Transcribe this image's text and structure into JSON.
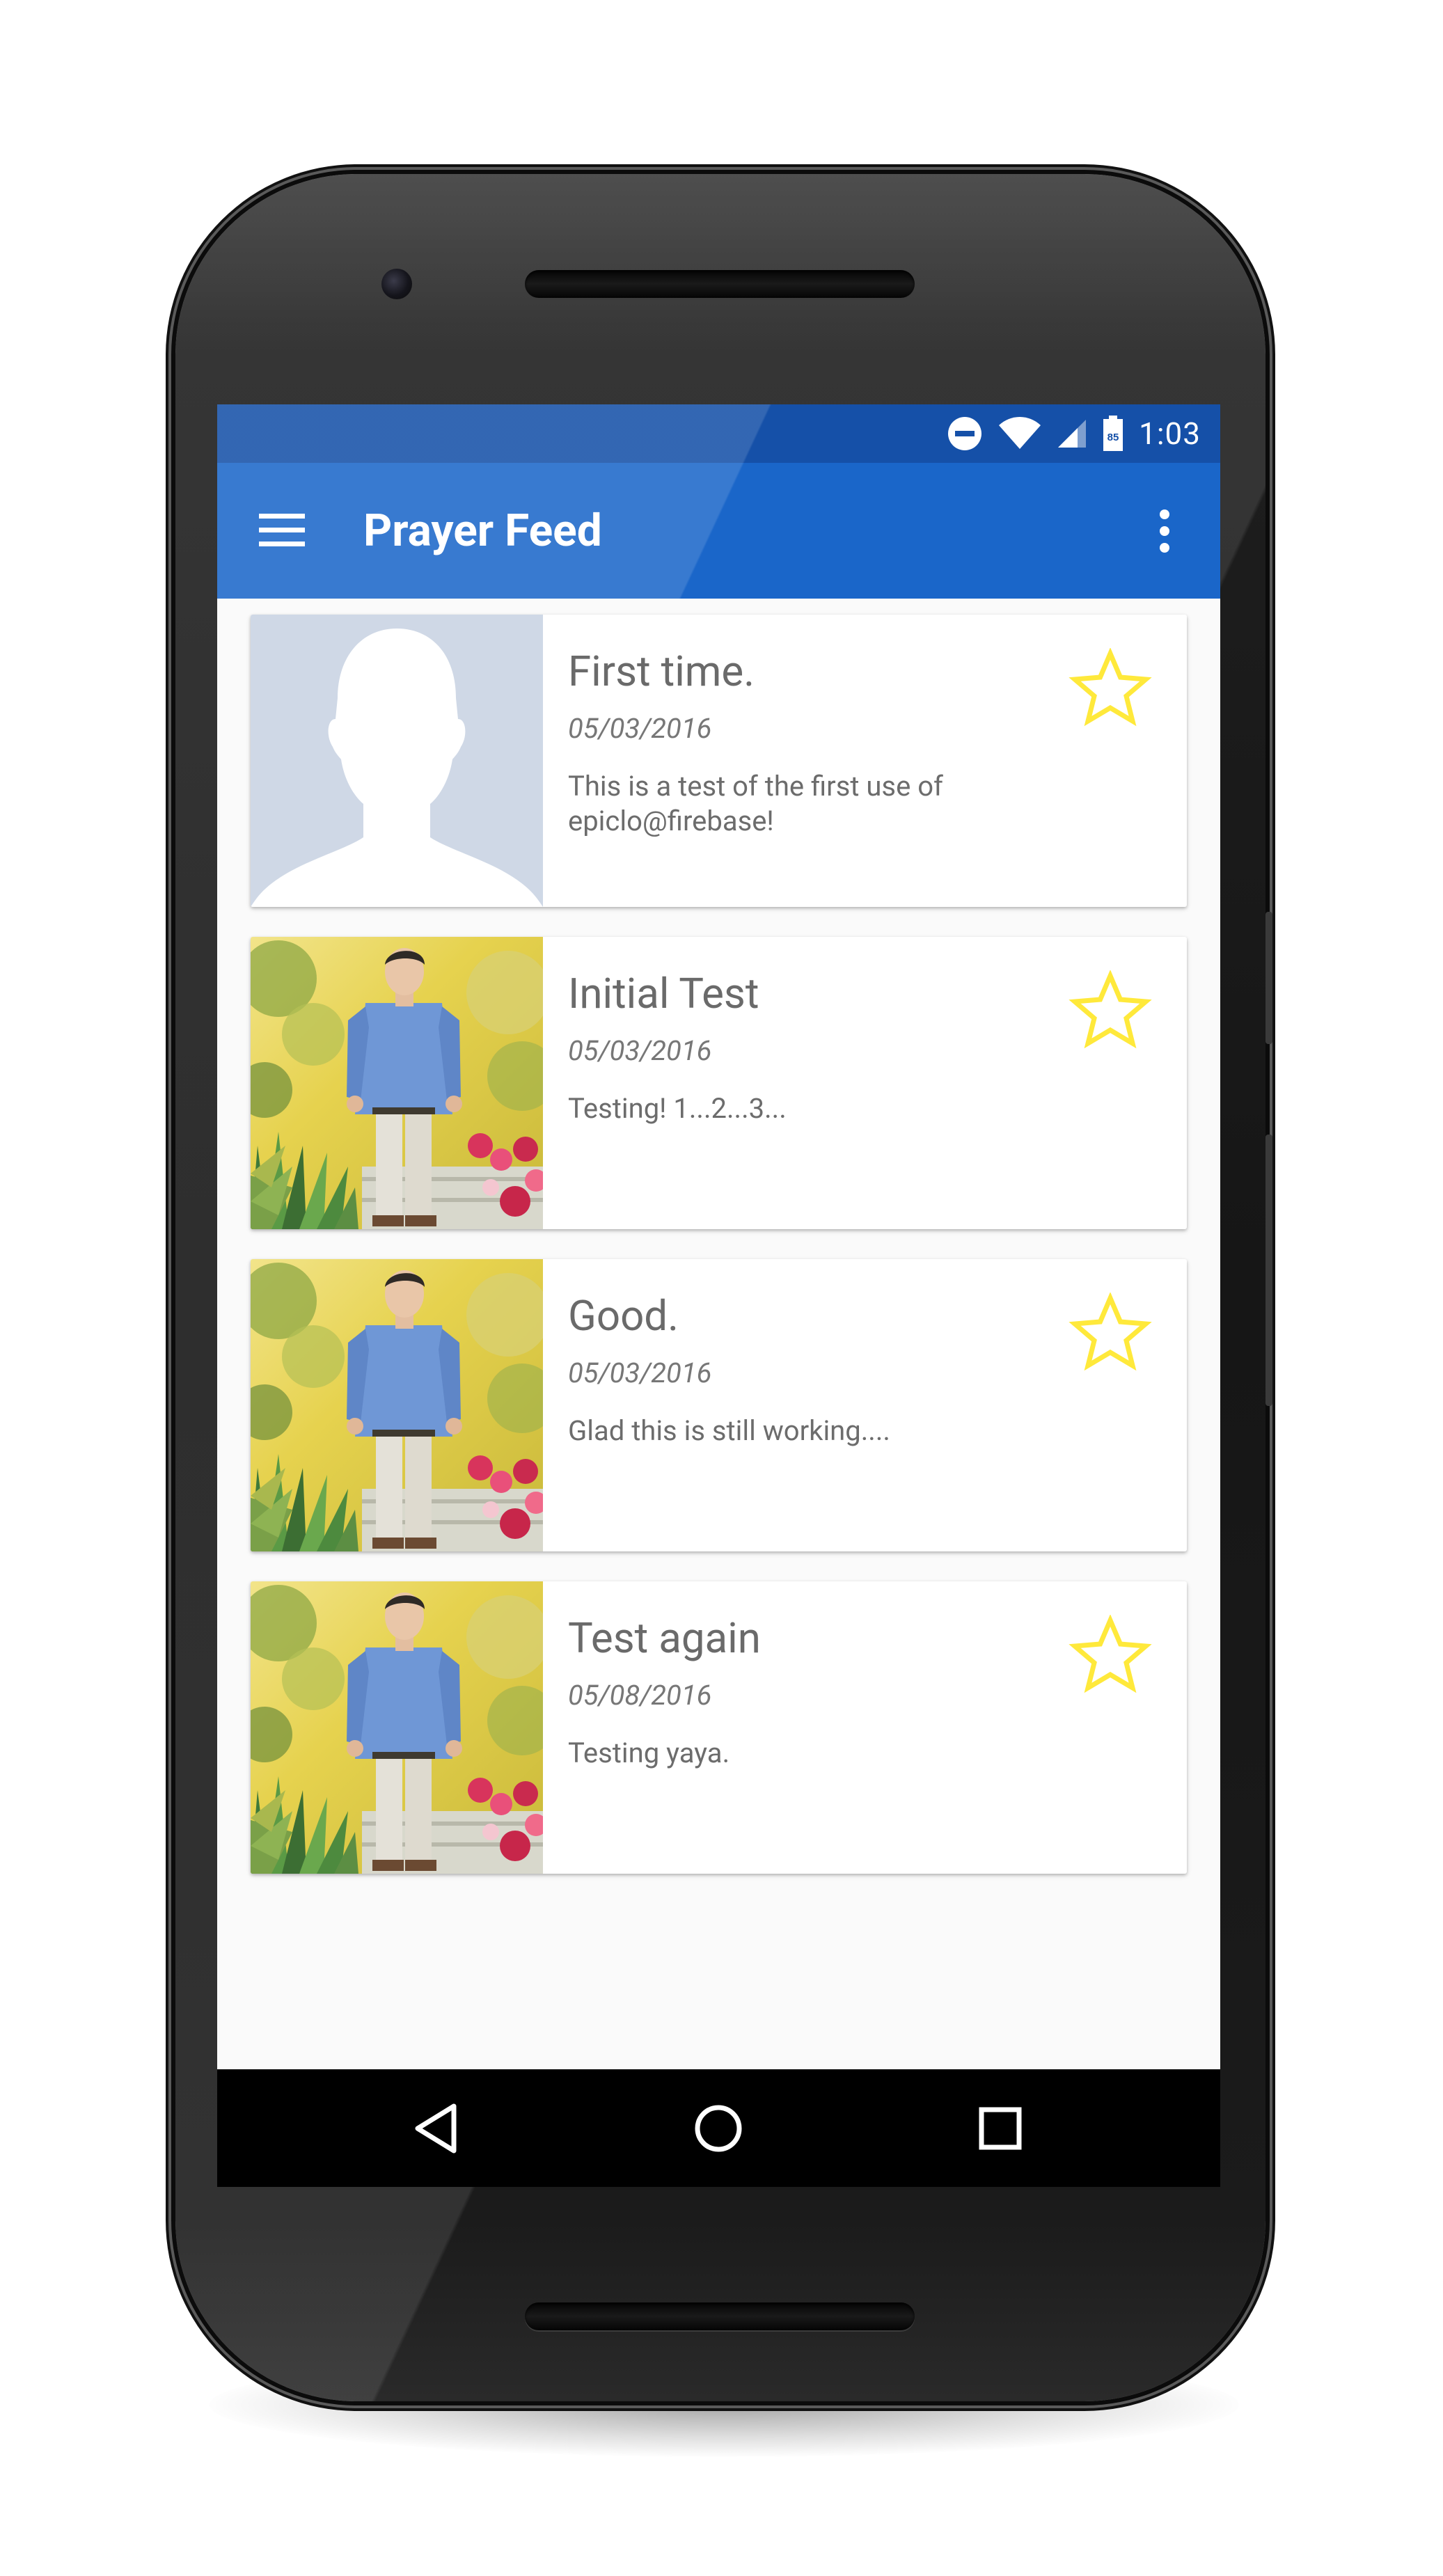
{
  "status_bar": {
    "time": "1:03",
    "battery_level": "85",
    "icons": [
      "do-not-disturb-icon",
      "wifi-icon",
      "cell-signal-icon",
      "battery-icon"
    ]
  },
  "app_bar": {
    "title": "Prayer Feed",
    "menu_icon": "hamburger-menu-icon",
    "overflow_icon": "more-vert-icon"
  },
  "feed": {
    "items": [
      {
        "title": "First time.",
        "date": "05/03/2016",
        "body": "This is a test of the first use of epiclo@firebase!",
        "image": "default-avatar-silhouette",
        "favorite_icon": "star-outline-icon"
      },
      {
        "title": "Initial Test",
        "date": "05/03/2016",
        "body": "Testing! 1...2...3...",
        "image": "person-photo-garden",
        "favorite_icon": "star-outline-icon"
      },
      {
        "title": "Good.",
        "date": "05/03/2016",
        "body": "Glad this is still working....",
        "image": "person-photo-garden",
        "favorite_icon": "star-outline-icon"
      },
      {
        "title": "Test again",
        "date": "05/08/2016",
        "body": "Testing yaya.",
        "image": "person-photo-garden",
        "favorite_icon": "star-outline-icon"
      }
    ]
  },
  "nav_bar": {
    "buttons": [
      "back-icon",
      "home-icon",
      "recents-icon"
    ]
  },
  "colors": {
    "status_bar": "#1550a8",
    "app_bar": "#1a66c9",
    "star": "#ffe93b",
    "card_text": "#6a6a6a",
    "background": "#fafafa"
  }
}
